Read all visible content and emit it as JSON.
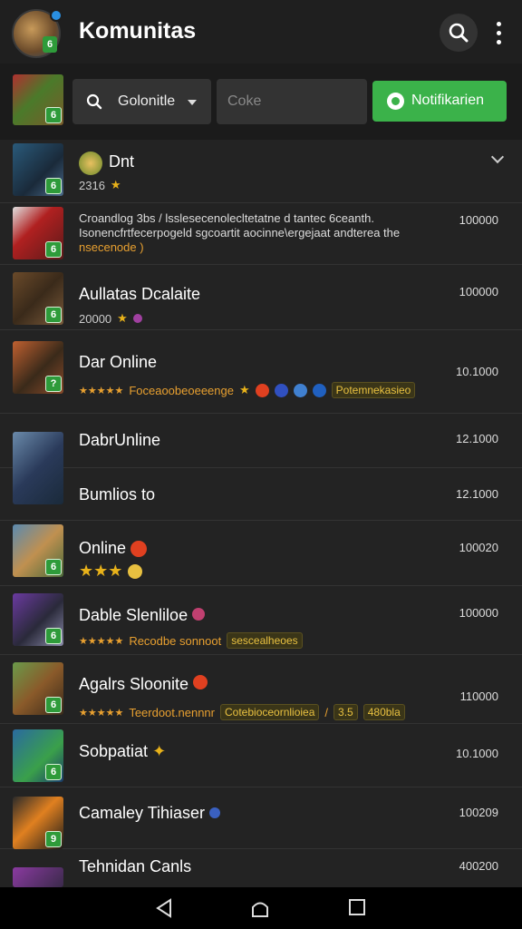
{
  "header": {
    "title": "Komunitas",
    "search_icon": "search-icon",
    "more_icon": "more-vert-icon"
  },
  "filters": {
    "dropdown_label": "Golonitle",
    "input_placeholder": "Coke",
    "notify_label": "Notifikarien"
  },
  "rows": [
    {
      "name": "Dnt",
      "sub": "2316",
      "num": ""
    },
    {
      "line1": "Croandlog 3bs / lsslesecenolecltetatne d tantec 6ceanth.",
      "line2": "Isonencfrtfecerpogeld sgcoartit aocinne\\ergejaat andterea the",
      "line3": "nsecenode )",
      "num": "100000"
    },
    {
      "name": "Aullatas Dcalaite",
      "sub": "20000",
      "num": "100000"
    },
    {
      "name": "Dar Online",
      "sub": "Foceaoobeoeeenge",
      "tag": "Potemnekasieo",
      "num": "10.1000"
    },
    {
      "name": "DabrUnline",
      "num": "12.1000"
    },
    {
      "name": "Bumlios to",
      "num": "12.1000"
    },
    {
      "name": "Online",
      "num": "100020"
    },
    {
      "name": "Dable Slenliloe",
      "sub": "Recodbe sonnoot",
      "tag": "sescealheoes",
      "num": "100000"
    },
    {
      "name": "Agalrs Sloonite",
      "sub": "Teerdoot.nennnr",
      "tag": "Cotebioceornlioiea",
      "tag2": "3.5",
      "tag3": "480bla",
      "extra": "/",
      "num": "110000"
    },
    {
      "name": "Sobpatiat",
      "num": "10.1000"
    },
    {
      "name": "Camaley Tihiaser",
      "num": "100209"
    },
    {
      "name": "Tehnidan Canls",
      "num": "400200"
    }
  ],
  "colors": {
    "accent": "#3bb24a",
    "tag": "#e8c040",
    "star": "#e8b21a"
  }
}
